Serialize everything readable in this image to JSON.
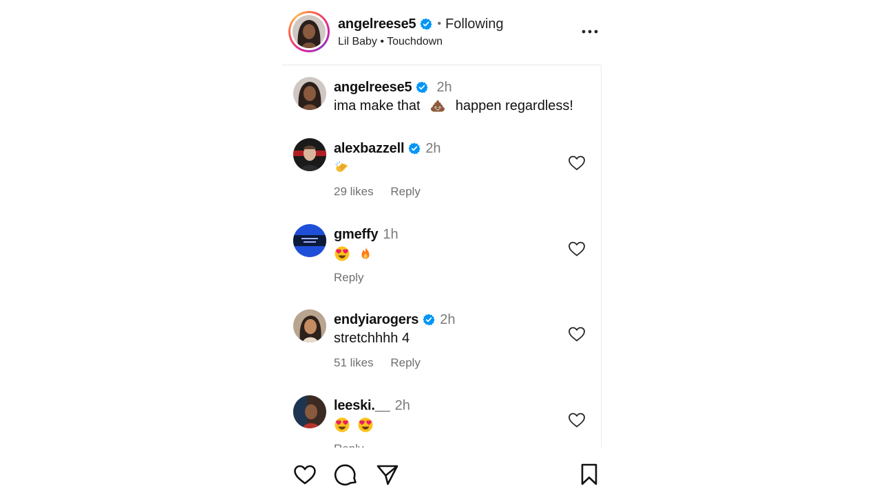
{
  "header": {
    "username": "angelreese5",
    "separator": "•",
    "follow_label": "Following",
    "audio": "Lil Baby • Touchdown"
  },
  "caption": {
    "username": "angelreese5",
    "time": "2h",
    "text_before": "ima make that",
    "emoji": "poop-emoji",
    "text_after": "happen regardless!"
  },
  "comments": [
    {
      "username": "alexbazzell",
      "verified": true,
      "time": "2h",
      "emojis": [
        "clapping-hands-emoji"
      ],
      "likes": "29 likes",
      "reply": "Reply"
    },
    {
      "username": "gmeffy",
      "verified": false,
      "time": "1h",
      "emojis": [
        "heart-eyes-emoji",
        "fire-emoji"
      ],
      "likes": "",
      "reply": "Reply"
    },
    {
      "username": "endyiarogers",
      "verified": true,
      "time": "2h",
      "text": "stretchhhh 4",
      "likes": "51 likes",
      "reply": "Reply"
    },
    {
      "username": "leeski.__",
      "verified": false,
      "time": "2h",
      "emojis": [
        "heart-eyes-emoji",
        "heart-eyes-emoji"
      ],
      "likes": "",
      "reply": "Reply"
    }
  ],
  "icons": {
    "more": "more-options-icon",
    "heart": "heart-icon",
    "comment": "comment-icon",
    "share": "send-icon",
    "save": "bookmark-icon",
    "verified": "verified-badge-icon"
  },
  "colors": {
    "verified": "#0095f6",
    "secondary_text": "#737373",
    "divider": "#e6e6e6"
  }
}
